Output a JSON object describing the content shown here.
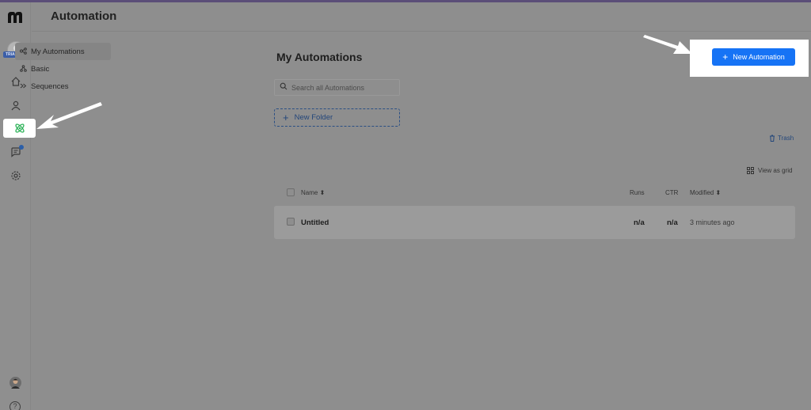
{
  "app": {
    "logo": "m",
    "trial_badge": "TRIAL",
    "help_glyph": "?"
  },
  "header": {
    "title": "Automation"
  },
  "rail": {
    "icons": [
      "home-icon",
      "user-icon",
      "automation-icon",
      "chat-icon",
      "settings-icon"
    ]
  },
  "subnav": {
    "items": [
      {
        "label": "My Automations",
        "icon": "automation-icon",
        "active": true
      },
      {
        "label": "Basic",
        "icon": "basic-icon",
        "active": false
      },
      {
        "label": "Sequences",
        "icon": "sequences-icon",
        "active": false
      }
    ]
  },
  "main": {
    "title": "My Automations",
    "new_automation_label": "New Automation",
    "search_placeholder": "Search all Automations",
    "new_folder_label": "New Folder",
    "trash_label": "Trash",
    "view_grid_label": "View as grid"
  },
  "table": {
    "headers": {
      "name": "Name",
      "runs": "Runs",
      "ctr": "CTR",
      "modified": "Modified"
    },
    "rows": [
      {
        "name": "Untitled",
        "runs": "n/a",
        "ctr": "n/a",
        "modified": "3 minutes ago"
      }
    ]
  },
  "colors": {
    "accent": "#1673f5",
    "link": "#23467a",
    "overlay": "#8e8e8e"
  }
}
